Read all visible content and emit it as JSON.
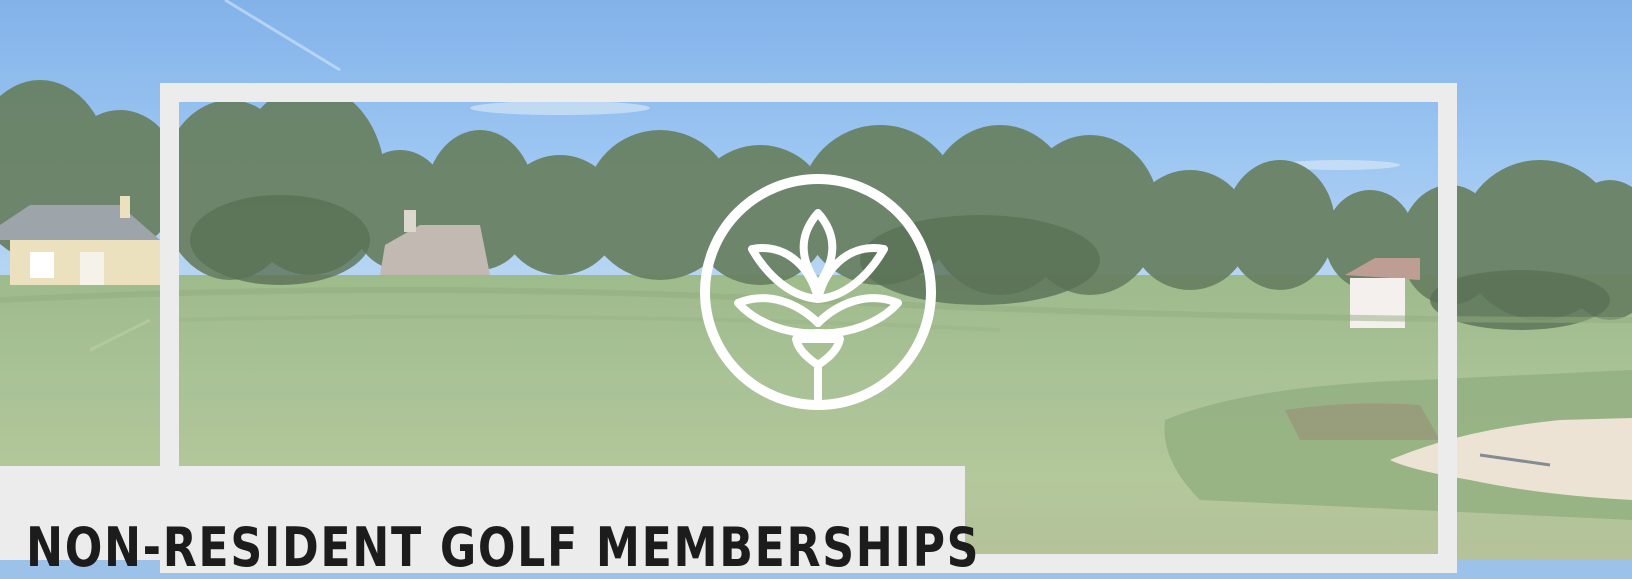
{
  "hero": {
    "title": "NON-RESIDENT GOLF MEMBERSHIPS",
    "logo_icon": "lotus-icon"
  },
  "colors": {
    "frame": "#ececec",
    "title_panel": "#ececec",
    "title_text": "#1c1c1c",
    "logo": "#ffffff"
  }
}
